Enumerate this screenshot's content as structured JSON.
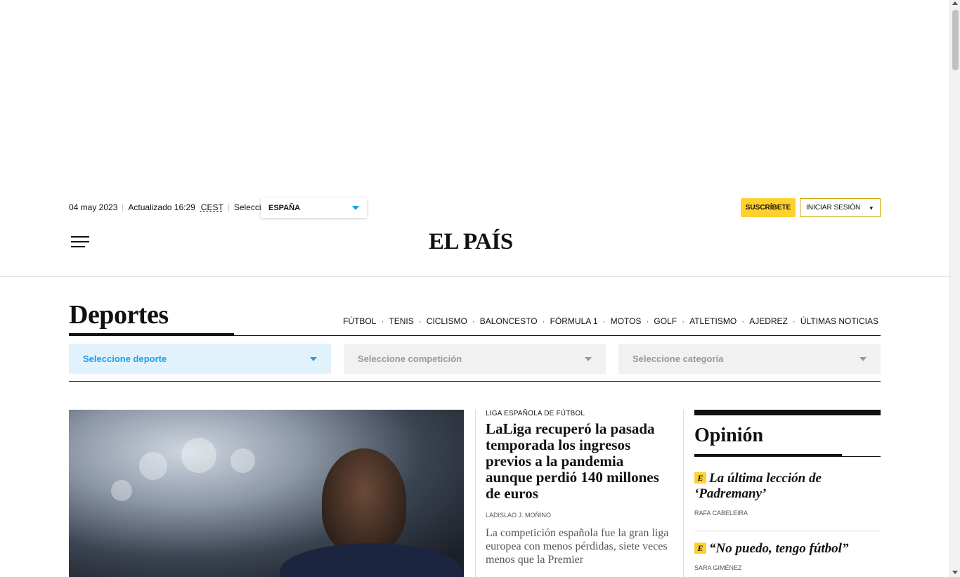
{
  "header": {
    "date": "04 may 2023",
    "updated_label": "Actualizado 16:29",
    "timezone": "CEST",
    "select_label": "Seleccione:",
    "edition": "ESPAÑA",
    "subscribe_label": "SUSCRÍBETE",
    "login_label": "INICIAR SESIÓN",
    "login_arrow": "▾",
    "logo": "EL PAÍS"
  },
  "section": {
    "title": "Deportes",
    "nav": [
      "FÚTBOL",
      "TENIS",
      "CICLISMO",
      "BALONCESTO",
      "FÓRMULA 1",
      "MOTOS",
      "GOLF",
      "ATLETISMO",
      "AJEDREZ",
      "ÚLTIMAS NOTICIAS"
    ],
    "separator": "·"
  },
  "filters": {
    "sport": "Seleccione deporte",
    "competition": "Seleccione competición",
    "category": "Seleccione categoría"
  },
  "lead": {
    "kicker": "LIGA ESPAÑOLA DE FÚTBOL",
    "headline": "LaLiga recuperó la pasada temporada los ingresos previos a la pandemia aunque perdió 140 millones de euros",
    "byline": "LADISLAO J. MOÑINO",
    "summary": "La competición española fue la gran liga europea con menos pérdidas, siete veces menos que la Premier"
  },
  "opinion": {
    "title": "Opinión",
    "badge": "E",
    "items": [
      {
        "headline": "La última lección de ‘Padremany’",
        "author": "RAFA CABELEIRA"
      },
      {
        "headline": "“No puedo, tengo fútbol”",
        "author": "SARA GIMÉNEZ"
      }
    ]
  },
  "colors": {
    "accent_blue": "#1d9ee6",
    "subscribe_yellow": "#ffd02e",
    "text": "#111111"
  }
}
